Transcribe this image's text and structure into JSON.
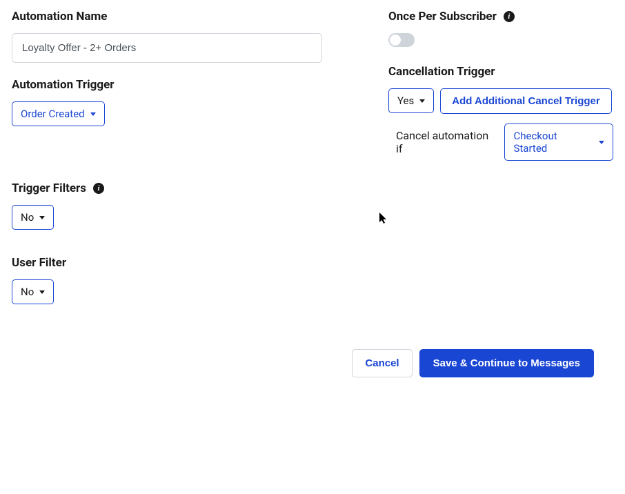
{
  "left": {
    "automation_name": {
      "label": "Automation Name",
      "value": "Loyalty Offer - 2+ Orders"
    },
    "automation_trigger": {
      "label": "Automation Trigger",
      "value": "Order Created"
    },
    "trigger_filters": {
      "label": "Trigger Filters",
      "value": "No"
    },
    "user_filter": {
      "label": "User Filter",
      "value": "No"
    }
  },
  "right": {
    "once_per_subscriber": {
      "label": "Once Per Subscriber"
    },
    "cancellation_trigger": {
      "label": "Cancellation Trigger",
      "yes": "Yes",
      "add_additional": "Add Additional Cancel Trigger",
      "cancel_if_text": "Cancel automation if",
      "cancel_if_value": "Checkout Started"
    }
  },
  "footer": {
    "cancel": "Cancel",
    "save": "Save & Continue to Messages"
  }
}
